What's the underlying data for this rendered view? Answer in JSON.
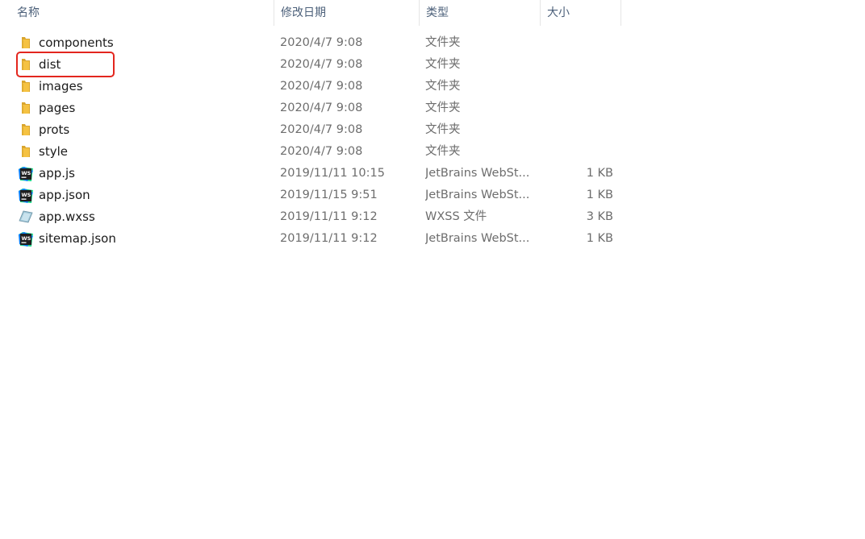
{
  "columns": {
    "name": "名称",
    "date": "修改日期",
    "type": "类型",
    "size": "大小"
  },
  "sort_indicator": "^",
  "colors": {
    "folder": "#f5c242",
    "highlight": "#e3261e",
    "webstorm_bg": "#1f1f1f",
    "webstorm_accent": "#21d789"
  },
  "files": [
    {
      "name": "components",
      "date": "2020/4/7 9:08",
      "type": "文件夹",
      "size": "",
      "icon": "folder-icon"
    },
    {
      "name": "dist",
      "date": "2020/4/7 9:08",
      "type": "文件夹",
      "size": "",
      "icon": "folder-icon"
    },
    {
      "name": "images",
      "date": "2020/4/7 9:08",
      "type": "文件夹",
      "size": "",
      "icon": "folder-icon"
    },
    {
      "name": "pages",
      "date": "2020/4/7 9:08",
      "type": "文件夹",
      "size": "",
      "icon": "folder-icon"
    },
    {
      "name": "prots",
      "date": "2020/4/7 9:08",
      "type": "文件夹",
      "size": "",
      "icon": "folder-icon"
    },
    {
      "name": "style",
      "date": "2020/4/7 9:08",
      "type": "文件夹",
      "size": "",
      "icon": "folder-icon"
    },
    {
      "name": "app.js",
      "date": "2019/11/11 10:15",
      "type": "JetBrains WebSt...",
      "size": "1 KB",
      "icon": "webstorm-icon"
    },
    {
      "name": "app.json",
      "date": "2019/11/15 9:51",
      "type": "JetBrains WebSt...",
      "size": "1 KB",
      "icon": "webstorm-icon"
    },
    {
      "name": "app.wxss",
      "date": "2019/11/11 9:12",
      "type": "WXSS 文件",
      "size": "3 KB",
      "icon": "wxss-file-icon"
    },
    {
      "name": "sitemap.json",
      "date": "2019/11/11 9:12",
      "type": "JetBrains WebSt...",
      "size": "1 KB",
      "icon": "webstorm-icon"
    }
  ],
  "webstorm_badge": "WS"
}
